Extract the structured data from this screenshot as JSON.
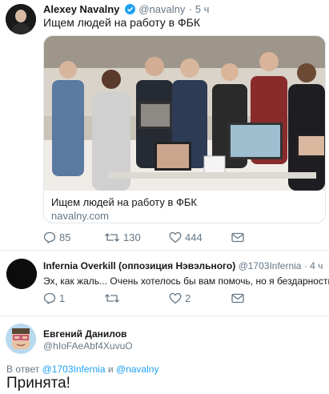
{
  "tweet1": {
    "name": "Alexey Navalny",
    "handle": "@navalny",
    "time": "· 5 ч",
    "text": "Ищем людей на работу в ФБК",
    "card": {
      "title": "Ищем людей на работу в ФБК",
      "url": "navalny.com"
    },
    "actions": {
      "replies": "85",
      "retweets": "130",
      "likes": "444"
    }
  },
  "tweet2": {
    "name": "Infernia Overkill (оппозиция Нэвэльного)",
    "handle": "@1703Infernia",
    "time": "· 4 ч",
    "avatar_text": "",
    "text": "Эх, как жаль... Очень хотелось бы вам помочь, но я бездарность)))",
    "actions": {
      "replies": "1",
      "retweets": "",
      "likes": "2"
    }
  },
  "tweet3": {
    "name": "Евгений Данилов",
    "handle": "@hIoFAeAbf4XuvuO",
    "reply_prefix": "В ответ",
    "reply_user1": "@1703Infernia",
    "reply_and": "и",
    "reply_user2": "@navalny",
    "text": "Принята!"
  },
  "colors": {
    "accent": "#1da1f2",
    "muted": "#657786",
    "text": "#14171a"
  }
}
